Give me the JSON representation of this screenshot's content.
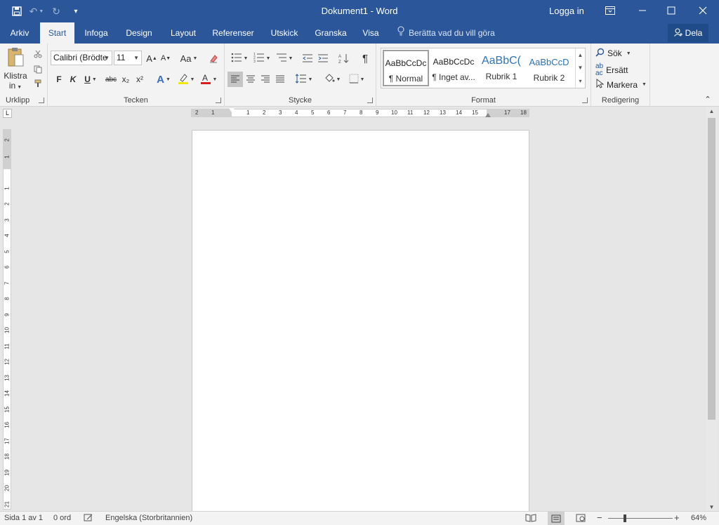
{
  "app": {
    "title": "Dokument1  -  Word",
    "login": "Logga in"
  },
  "quick_access": {
    "save_icon": "save-icon",
    "undo_icon": "undo-icon",
    "redo_icon": "redo-icon",
    "customize_icon": "customize-qat-icon"
  },
  "tabs": [
    {
      "label": "Arkiv"
    },
    {
      "label": "Start"
    },
    {
      "label": "Infoga"
    },
    {
      "label": "Design"
    },
    {
      "label": "Layout"
    },
    {
      "label": "Referenser"
    },
    {
      "label": "Utskick"
    },
    {
      "label": "Granska"
    },
    {
      "label": "Visa"
    }
  ],
  "active_tab": "Start",
  "tell_me": "Berätta vad du vill göra",
  "share": "Dela",
  "ribbon": {
    "clipboard": {
      "label": "Urklipp",
      "paste": "Klistra",
      "paste_line2": "in"
    },
    "font": {
      "label": "Tecken",
      "font_name": "Calibri (Brödte",
      "font_size": "11",
      "bold": "F",
      "italic": "K",
      "underline": "U",
      "strike": "abc",
      "subscript": "x₂",
      "superscript": "x²",
      "change_case": "Aa",
      "grow": "A",
      "shrink": "A",
      "font_color_hex": "#d42020",
      "highlight_hex": "#f2e700"
    },
    "paragraph": {
      "label": "Stycke",
      "pilcrow": "¶"
    },
    "styles": {
      "label": "Format",
      "items": [
        {
          "preview": "AaBbCcDc",
          "name": "¶ Normal"
        },
        {
          "preview": "AaBbCcDc",
          "name": "¶ Inget av..."
        },
        {
          "preview": "AaBbC(",
          "name": "Rubrik 1"
        },
        {
          "preview": "AaBbCcD",
          "name": "Rubrik 2"
        }
      ]
    },
    "editing": {
      "label": "Redigering",
      "find": "Sök",
      "replace": "Ersätt",
      "select": "Markera"
    }
  },
  "ruler": {
    "h_labels": [
      "2",
      "1",
      "1",
      "2",
      "3",
      "4",
      "5",
      "6",
      "7",
      "8",
      "9",
      "10",
      "11",
      "12",
      "13",
      "14",
      "15",
      "17",
      "18"
    ],
    "v_labels": [
      "2",
      "1",
      "1",
      "2",
      "3",
      "4",
      "5",
      "6",
      "7",
      "8",
      "9",
      "10",
      "11",
      "12",
      "13",
      "14",
      "15",
      "16",
      "17",
      "18",
      "19",
      "20",
      "21"
    ],
    "tab_selector": "L"
  },
  "status": {
    "page": "Sida 1 av 1",
    "words": "0 ord",
    "language": "Engelska (Storbritannien)",
    "zoom": "64%",
    "zoom_minus": "−",
    "zoom_plus": "+"
  },
  "colors": {
    "brand": "#2b579a",
    "ribbon_bg": "#f3f3f3",
    "canvas_bg": "#e6e6e6"
  }
}
